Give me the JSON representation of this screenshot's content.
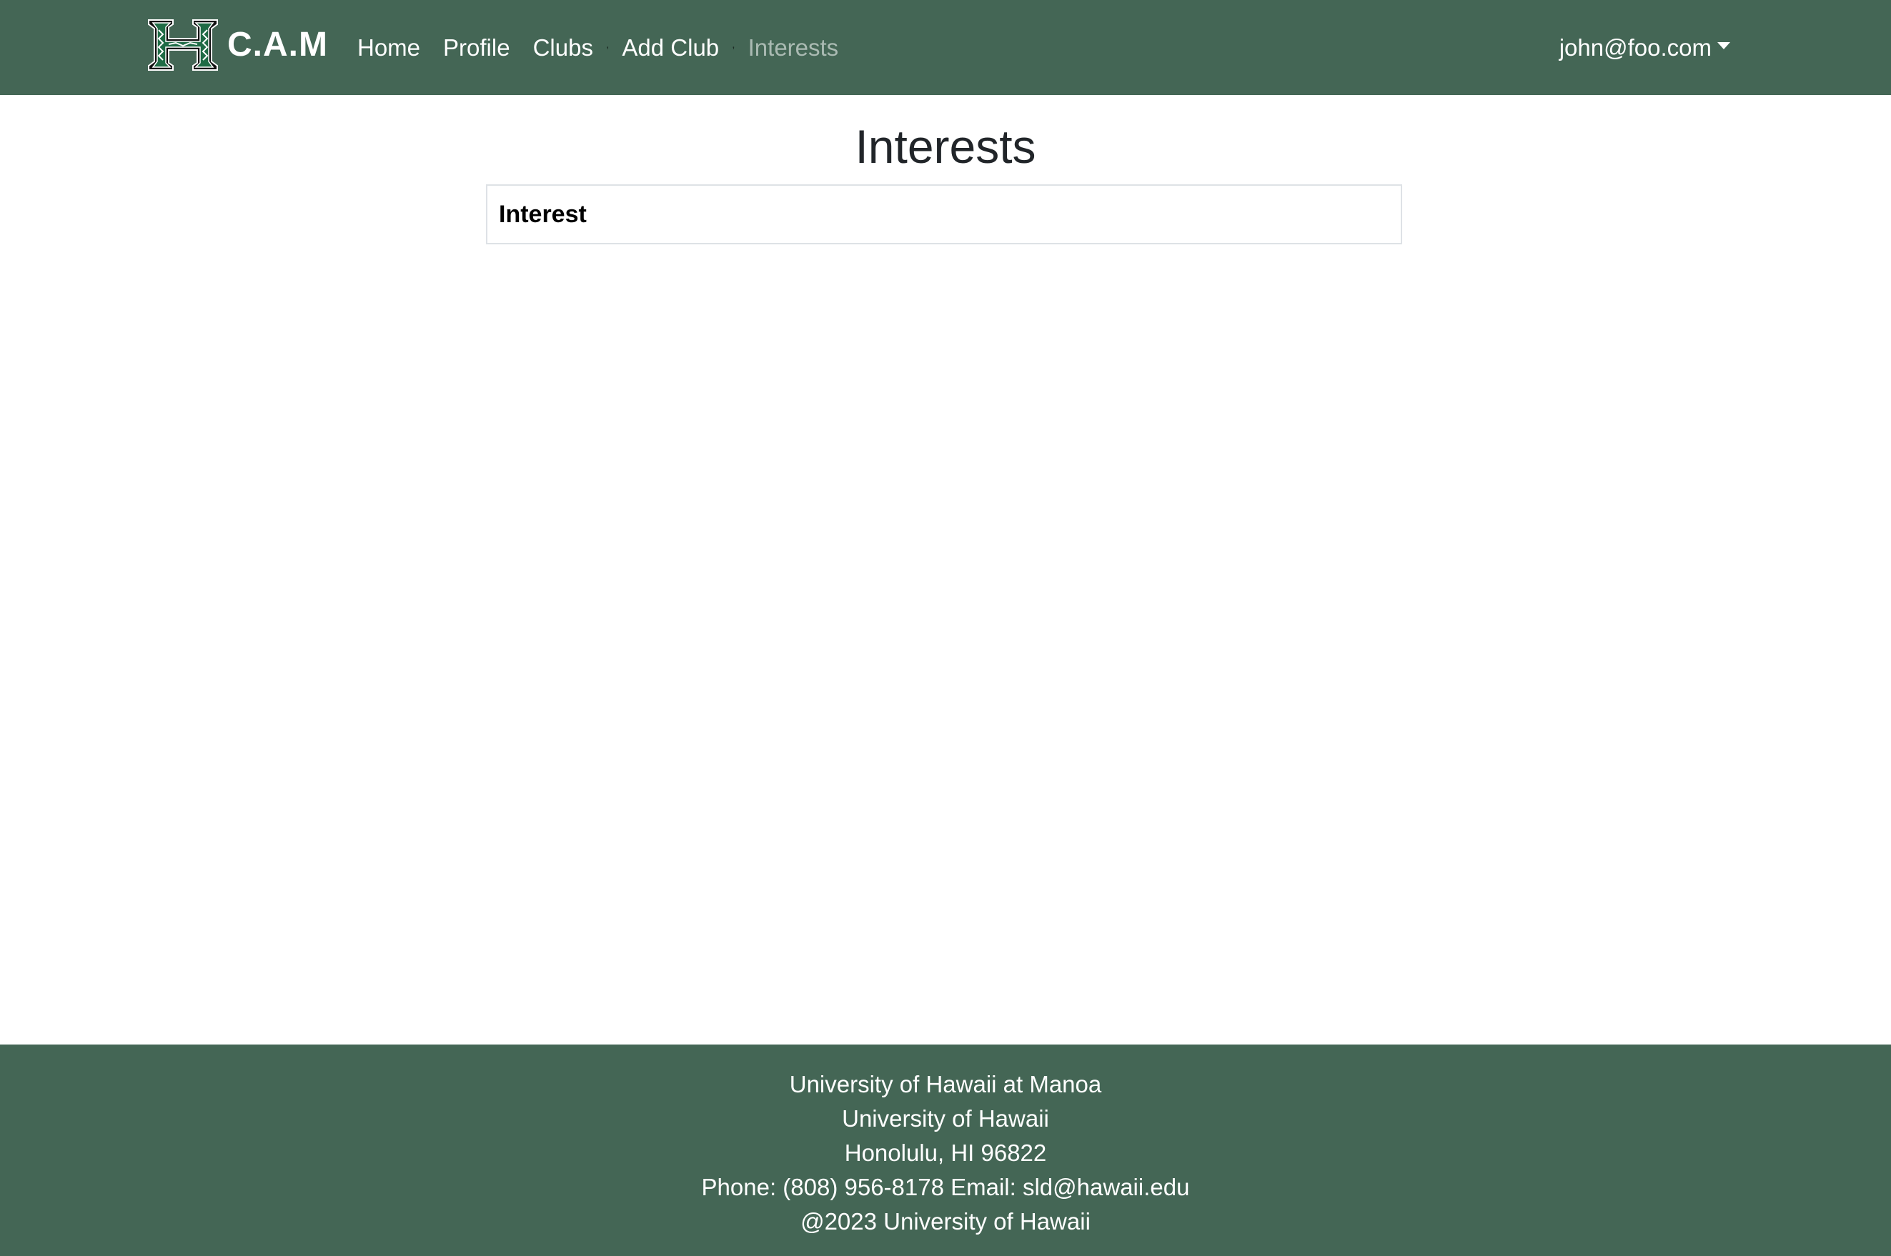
{
  "navbar": {
    "brand_text": "C.A.M",
    "links": [
      {
        "label": "Home"
      },
      {
        "label": "Profile"
      },
      {
        "label": "Clubs"
      },
      {
        "label": "Add Club"
      },
      {
        "label": "Interests"
      }
    ],
    "separator": ",",
    "user_email": "john@foo.com"
  },
  "main": {
    "title": "Interests",
    "table_header": "Interest"
  },
  "footer": {
    "line1": "University of Hawaii at Manoa",
    "line2": "University of Hawaii",
    "line3": "Honolulu, HI 96822",
    "line4": "Phone: (808) 956-8178 Email: sld@hawaii.edu",
    "line5": "@2023 University of Hawaii"
  },
  "colors": {
    "brand_green": "#446655",
    "text_white": "#ffffff",
    "active_link": "rgba(255,255,255,0.55)"
  },
  "icons": {
    "logo": "uh-h-logo",
    "user_dropdown": "caret-down-icon"
  }
}
